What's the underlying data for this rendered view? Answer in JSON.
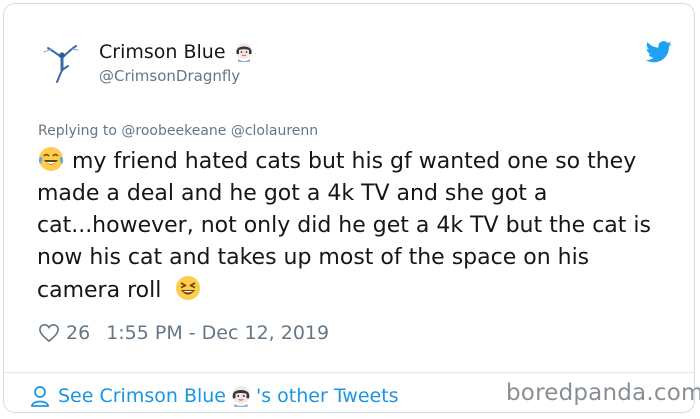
{
  "tweet": {
    "display_name": "Crimson Blue",
    "handle": "@CrimsonDragnfly",
    "reply_prefix": "Replying to",
    "reply_to": "@roobeekeane @clolaurenn",
    "text_main": "my friend hated cats but his gf wanted one so they made a deal and he got a 4k TV and she got a cat...however, not only did he get a 4k TV but the cat is now his cat and takes up most of the space on his camera roll",
    "likes": "26",
    "timestamp": "1:55 PM - Dec 12, 2019"
  },
  "footer": {
    "see_prefix": "See Crimson Blue",
    "see_suffix": "'s other Tweets"
  },
  "watermark": "boredpanda.com",
  "colors": {
    "link_blue": "#1b95e0",
    "twitter_blue": "#1da1f2",
    "secondary_text": "#657786"
  },
  "icons": [
    "ballerina-avatar",
    "woman-emoji",
    "twitter-bird-icon",
    "laughing-tears-emoji",
    "grinning-squint-emoji",
    "heart-icon",
    "user-icon"
  ]
}
